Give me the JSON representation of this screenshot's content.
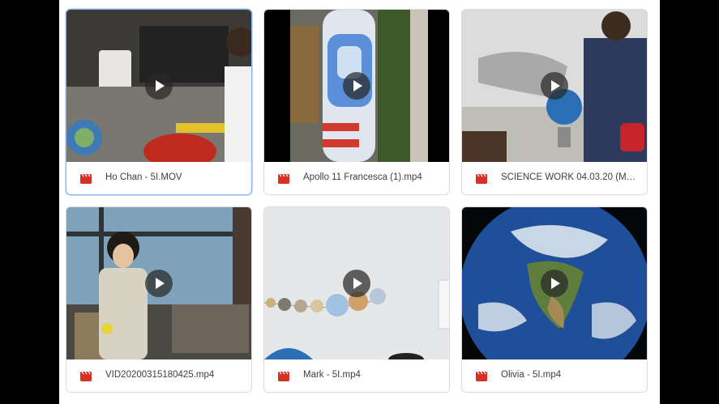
{
  "files": [
    {
      "name": "Ho Chan - 5I.MOV",
      "type_icon": "video-file-icon",
      "selected": true
    },
    {
      "name": "Apollo 11 Francesca (1).mp4",
      "type_icon": "video-file-icon",
      "selected": false
    },
    {
      "name": "SCIENCE WORK 04.03.20 (Mar ...",
      "type_icon": "video-file-icon",
      "selected": false
    },
    {
      "name": "VID20200315180425.mp4",
      "type_icon": "video-file-icon",
      "selected": false
    },
    {
      "name": "Mark - 5I.mp4",
      "type_icon": "video-file-icon",
      "selected": false
    },
    {
      "name": "Olivia - 5I.mp4",
      "type_icon": "video-file-icon",
      "selected": false
    }
  ],
  "colors": {
    "video_icon": "#d93025",
    "play_overlay": "#282828",
    "selected_border": "#8ab4f8"
  }
}
